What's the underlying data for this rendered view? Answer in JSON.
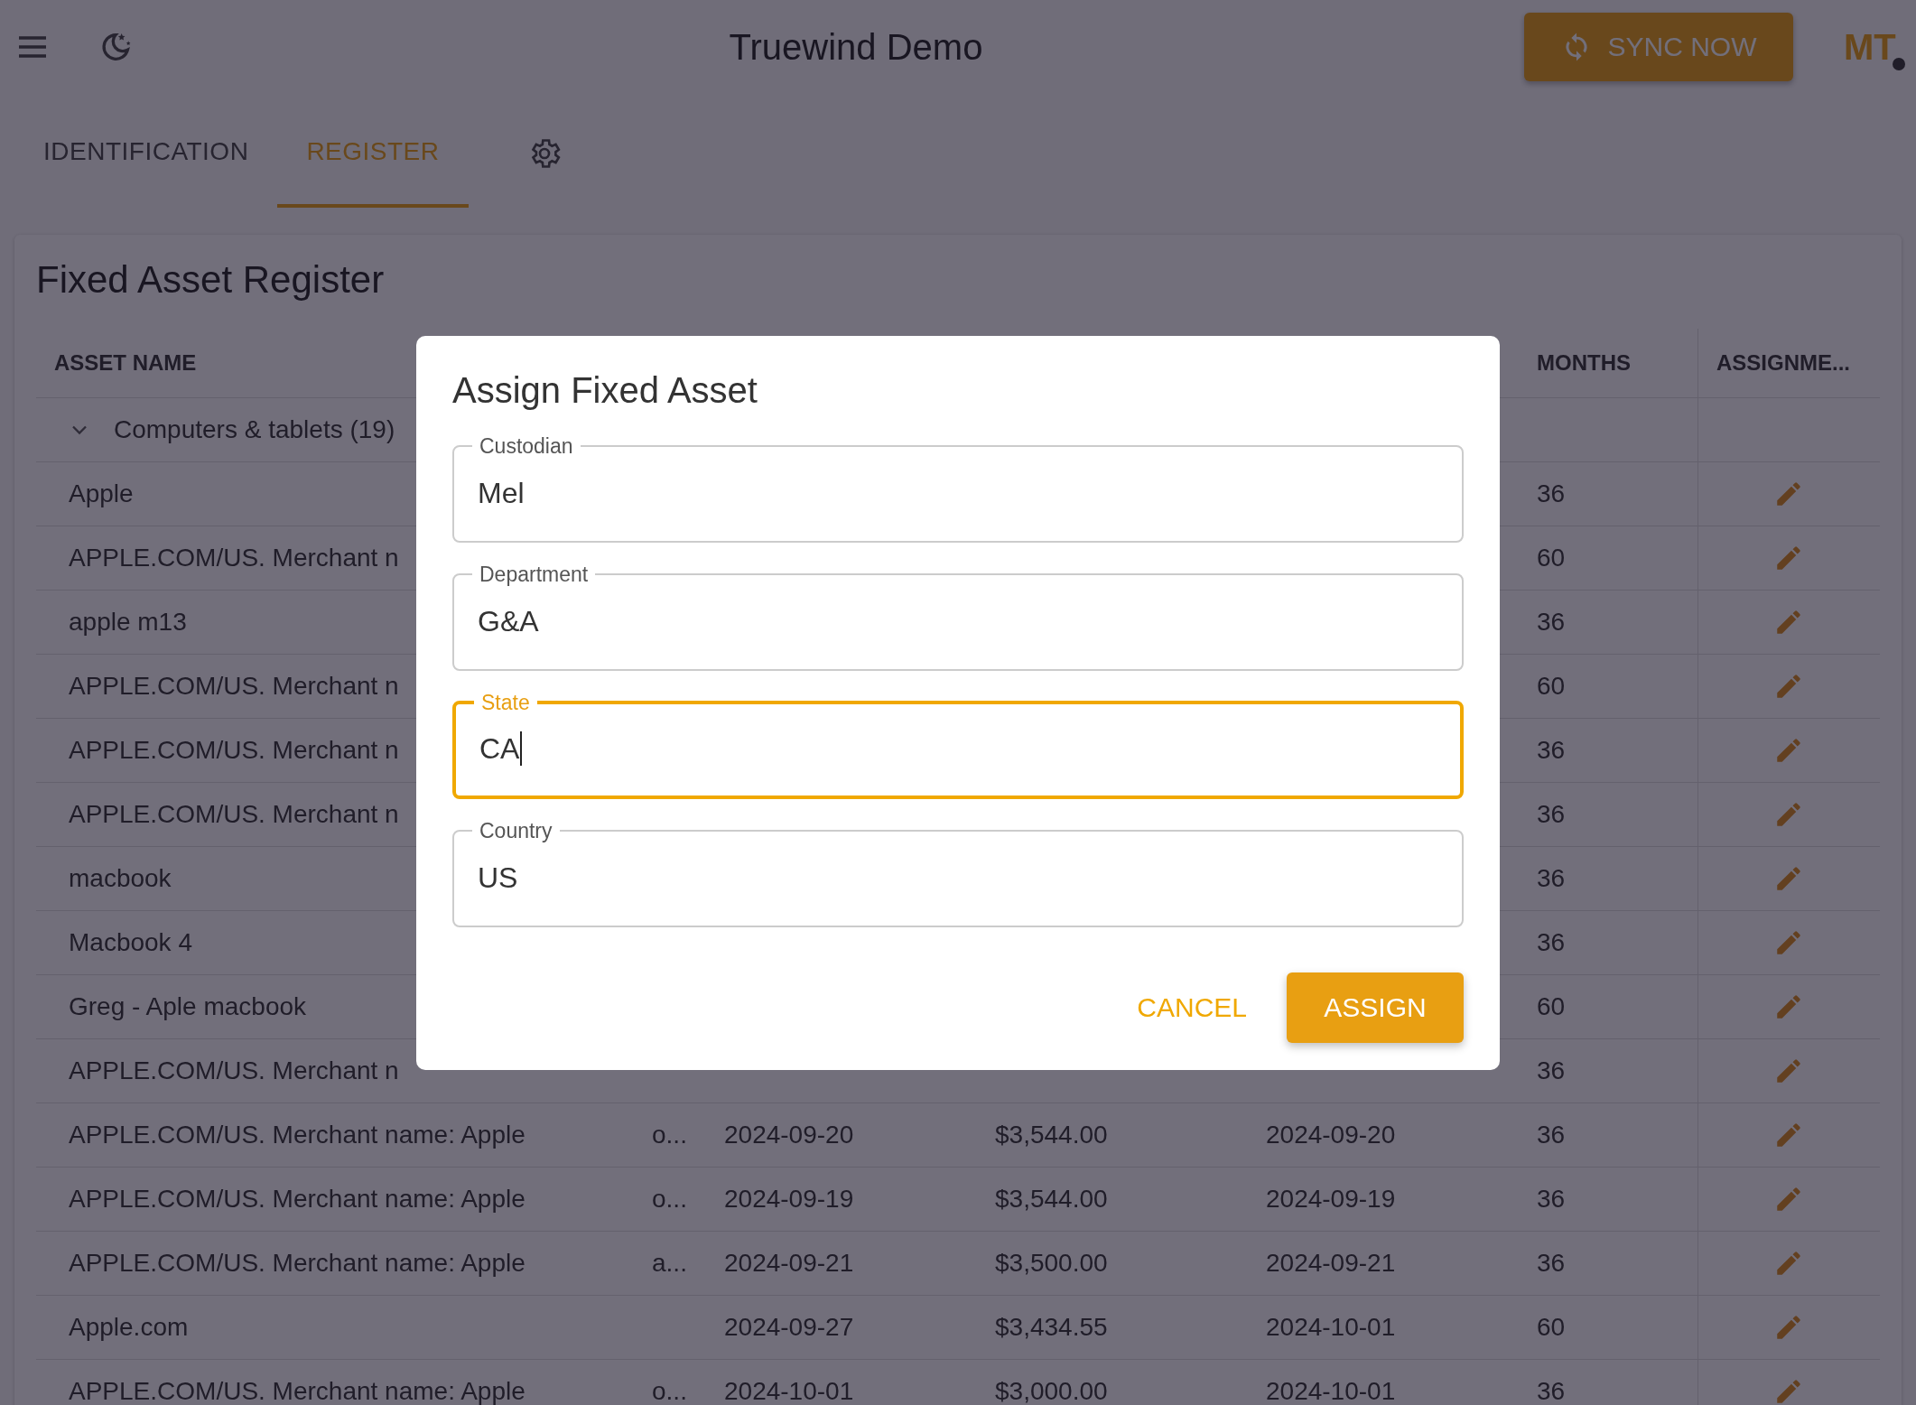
{
  "app_bar": {
    "title": "Truewind Demo",
    "sync_button": "SYNC NOW",
    "avatar": "MT"
  },
  "tabs": [
    {
      "label": "IDENTIFICATION",
      "selected": false
    },
    {
      "label": "REGISTER",
      "selected": true
    }
  ],
  "register": {
    "title": "Fixed Asset Register",
    "columns": {
      "asset_name": "ASSET NAME",
      "months": "MONTHS",
      "assignment": "ASSIGNME..."
    },
    "group": {
      "label": "Computers & tablets (19)",
      "expanded": true
    },
    "rows": [
      {
        "name": "Apple",
        "months": "36"
      },
      {
        "name": "APPLE.COM/US. Merchant n",
        "months": "60"
      },
      {
        "name": "apple m13",
        "months": "36"
      },
      {
        "name": "APPLE.COM/US. Merchant n",
        "months": "60"
      },
      {
        "name": "APPLE.COM/US. Merchant n",
        "months": "36"
      },
      {
        "name": "APPLE.COM/US. Merchant n",
        "months": "36"
      },
      {
        "name": "macbook",
        "months": "36"
      },
      {
        "name": "Macbook 4",
        "months": "36"
      },
      {
        "name": "Greg - Aple macbook",
        "months": "60"
      },
      {
        "name": "APPLE.COM/US. Merchant n",
        "months": "36"
      },
      {
        "name": "APPLE.COM/US. Merchant name: Apple",
        "column_2": "o...",
        "date": "2024-09-20",
        "cost": "$3,544.00",
        "date_2": "2024-09-20",
        "months": "36"
      },
      {
        "name": "APPLE.COM/US. Merchant name: Apple",
        "column_2": "o...",
        "date": "2024-09-19",
        "cost": "$3,544.00",
        "date_2": "2024-09-19",
        "months": "36"
      },
      {
        "name": "APPLE.COM/US. Merchant name: Apple",
        "column_2": "a...",
        "date": "2024-09-21",
        "cost": "$3,500.00",
        "date_2": "2024-09-21",
        "months": "36"
      },
      {
        "name": "Apple.com",
        "date": "2024-09-27",
        "cost": "$3,434.55",
        "date_2": "2024-10-01",
        "months": "60"
      },
      {
        "name": "APPLE.COM/US. Merchant name: Apple",
        "column_2": "o...",
        "date": "2024-10-01",
        "cost": "$3,000.00",
        "date_2": "2024-10-01",
        "months": "36"
      }
    ]
  },
  "dialog": {
    "title": "Assign Fixed Asset",
    "fields": [
      {
        "label": "Custodian",
        "value": "Mel",
        "focused": false
      },
      {
        "label": "Department",
        "value": "G&A",
        "focused": false
      },
      {
        "label": "State",
        "value": "CA",
        "focused": true
      },
      {
        "label": "Country",
        "value": "US",
        "focused": false
      }
    ],
    "cancel_button": "CANCEL",
    "assign_button": "ASSIGN"
  }
}
